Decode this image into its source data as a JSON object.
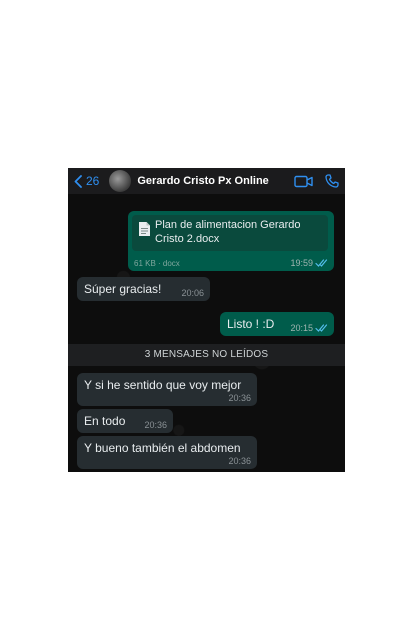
{
  "header": {
    "back_count": "26",
    "contact_name": "Gerardo Cristo Px Online"
  },
  "icons": {
    "back": "chevron-left-icon",
    "video": "video-call-icon",
    "phone": "phone-icon",
    "document": "document-icon",
    "ticks": "double-check-icon"
  },
  "colors": {
    "accent": "#2f8ff0",
    "outgoing_bubble": "#005c4b",
    "incoming_bubble": "#262d31",
    "read_ticks": "#53bdeb"
  },
  "messages": [
    {
      "direction": "out",
      "type": "document",
      "doc_title": "Plan de alimentacion Gerardo Cristo 2.docx",
      "doc_meta": "61 KB · docx",
      "time": "19:59"
    },
    {
      "direction": "in",
      "text": "Súper gracias!",
      "time": "20:06"
    },
    {
      "direction": "out",
      "text": "Listo ! :D",
      "time": "20:15"
    }
  ],
  "unread_divider": "3 MENSAJES NO LEÍDOS",
  "unread_messages": [
    {
      "direction": "in",
      "text": "Y si he sentido que voy mejor",
      "time": "20:36"
    },
    {
      "direction": "in",
      "text": "En todo",
      "time": "20:36"
    },
    {
      "direction": "in",
      "text": "Y bueno también el abdomen",
      "time": "20:36"
    }
  ]
}
